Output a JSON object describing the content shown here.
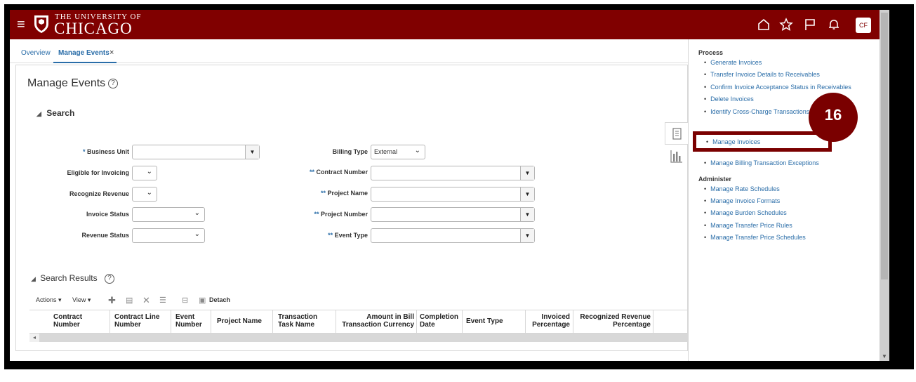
{
  "header": {
    "university_top": "THE UNIVERSITY OF",
    "university_main": "CHICAGO",
    "avatar": "CF"
  },
  "tabs": [
    {
      "label": "Overview"
    },
    {
      "label": "Manage Events"
    }
  ],
  "tab_close": "×",
  "page": {
    "title": "Manage Events",
    "search_label": "Search"
  },
  "form": {
    "business_unit": {
      "label": "Business Unit",
      "value": ""
    },
    "eligible": {
      "label": "Eligible for Invoicing",
      "value": ""
    },
    "recognize": {
      "label": "Recognize Revenue",
      "value": ""
    },
    "invoice_status": {
      "label": "Invoice Status",
      "value": ""
    },
    "revenue_status": {
      "label": "Revenue Status",
      "value": ""
    },
    "billing_type": {
      "label": "Billing Type",
      "value": "External"
    },
    "contract_number": {
      "label": "Contract Number",
      "value": ""
    },
    "project_name": {
      "label": "Project Name",
      "value": ""
    },
    "project_number": {
      "label": "Project Number",
      "value": ""
    },
    "event_type": {
      "label": "Event Type",
      "value": ""
    },
    "req_single": "*",
    "req_double": "**"
  },
  "results": {
    "title": "Search Results",
    "actions": "Actions ▾",
    "view": "View ▾",
    "detach": "Detach",
    "columns": [
      {
        "l1": "Contract",
        "l2": "Number"
      },
      {
        "l1": "Contract Line",
        "l2": "Number"
      },
      {
        "l1": "Event",
        "l2": "Number"
      },
      {
        "l1": "Project Name",
        "l2": ""
      },
      {
        "l1": "Transaction",
        "l2": "Task Name"
      },
      {
        "l1": "Amount in Bill",
        "l2": "Transaction Currency"
      },
      {
        "l1": "Completion",
        "l2": "Date"
      },
      {
        "l1": "Event Type",
        "l2": ""
      },
      {
        "l1": "Invoiced",
        "l2": "Percentage"
      },
      {
        "l1": "Recognized Revenue",
        "l2": "Percentage"
      }
    ]
  },
  "side_panel": {
    "process_title": "Process",
    "process_links": [
      "Generate Invoices",
      "Transfer Invoice Details to Receivables",
      "Confirm Invoice Acceptance Status in Receivables",
      "Delete Invoices",
      "Identify Cross-Charge Transactions"
    ],
    "highlight_link": "Manage Invoices",
    "after_link": "Manage Billing Transaction Exceptions",
    "administer_title": "Administer",
    "administer_links": [
      "Manage Rate Schedules",
      "Manage Invoice Formats",
      "Manage Burden Schedules",
      "Manage Transfer Price Rules",
      "Manage Transfer Price Schedules"
    ]
  },
  "callout": {
    "step": "16"
  },
  "colors": {
    "brand": "#800000",
    "link": "#2a6da8",
    "callout": "#7a0000"
  },
  "icons": [
    "menu-icon",
    "home-icon",
    "star-icon",
    "flag-icon",
    "bell-icon",
    "help-icon",
    "tasks-icon",
    "chart-icon",
    "add-icon",
    "delete-icon",
    "close-icon"
  ]
}
